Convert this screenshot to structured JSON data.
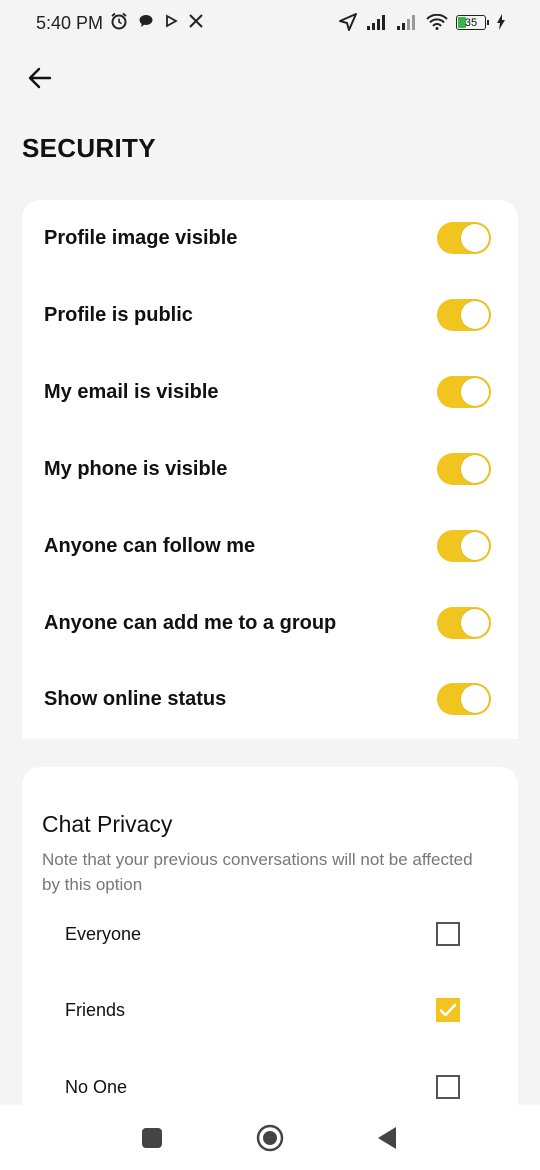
{
  "status_bar": {
    "time": "5:40 PM",
    "left_icons": [
      "alarm-icon",
      "chat-bubble-icon",
      "play-icon",
      "cutlery-icon"
    ],
    "right_icons": [
      "location-arrow-icon",
      "signal-icon",
      "signal-icon",
      "wifi-icon",
      "battery-icon",
      "charging-icon"
    ],
    "battery_level": "35"
  },
  "header": {
    "back_icon": "arrow-left-icon",
    "title": "SECURITY"
  },
  "security": {
    "accent_color": "#f2c41f",
    "settings": [
      {
        "label": "Profile image visible",
        "enabled": true
      },
      {
        "label": "Profile is public",
        "enabled": true
      },
      {
        "label": "My email is visible",
        "enabled": true
      },
      {
        "label": "My phone is visible",
        "enabled": true
      },
      {
        "label": "Anyone can follow me",
        "enabled": true
      },
      {
        "label": "Anyone can add me to a group",
        "enabled": true
      },
      {
        "label": "Show online status",
        "enabled": true
      }
    ]
  },
  "chat_privacy": {
    "title": "Chat Privacy",
    "note": "Note that your previous conversations will not be affected by this option",
    "options": [
      {
        "label": "Everyone",
        "checked": false
      },
      {
        "label": "Friends",
        "checked": true
      },
      {
        "label": "No One",
        "checked": false
      }
    ]
  },
  "nav_bar": {
    "buttons": [
      "recents-square-icon",
      "home-circle-icon",
      "back-triangle-icon"
    ]
  }
}
